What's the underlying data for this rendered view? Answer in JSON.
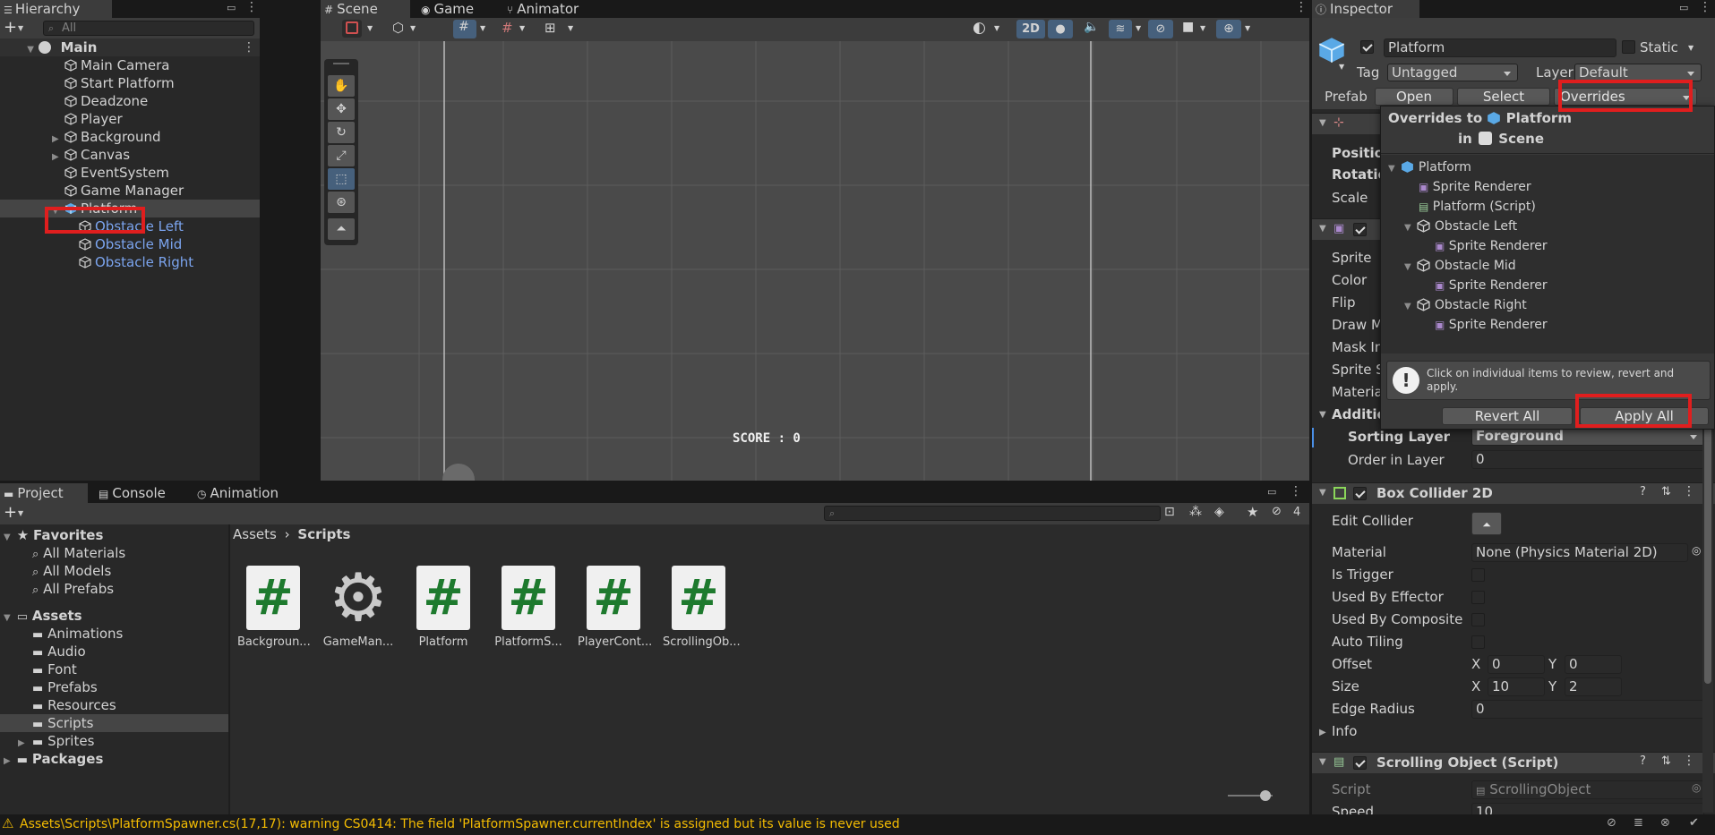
{
  "hierarchy": {
    "tab": "Hierarchy",
    "search_placeholder": "All",
    "scene": "Main",
    "items": [
      {
        "label": "Main Camera"
      },
      {
        "label": "Start Platform"
      },
      {
        "label": "Deadzone"
      },
      {
        "label": "Player"
      },
      {
        "label": "Background"
      },
      {
        "label": "Canvas"
      },
      {
        "label": "EventSystem"
      },
      {
        "label": "Game Manager"
      },
      {
        "label": "Platform"
      },
      {
        "label": "Obstacle Left"
      },
      {
        "label": "Obstacle Mid"
      },
      {
        "label": "Obstacle Right"
      }
    ]
  },
  "scene": {
    "tabs": [
      "Scene",
      "Game",
      "Animator"
    ],
    "mode_2d": "2D",
    "score_text": "SCORE : 0"
  },
  "project": {
    "tabs": [
      "Project",
      "Console",
      "Animation"
    ],
    "hidden_count": "4",
    "favorites": {
      "label": "Favorites",
      "items": [
        "All Materials",
        "All Models",
        "All Prefabs"
      ]
    },
    "assets": {
      "label": "Assets",
      "items": [
        "Animations",
        "Audio",
        "Font",
        "Prefabs",
        "Resources",
        "Scripts",
        "Sprites"
      ]
    },
    "packages": "Packages",
    "breadcrumb": [
      "Assets",
      "Scripts"
    ],
    "files": [
      {
        "name": "Backgroun...",
        "type": "script"
      },
      {
        "name": "GameMan...",
        "type": "gear"
      },
      {
        "name": "Platform",
        "type": "script"
      },
      {
        "name": "PlatformS...",
        "type": "script"
      },
      {
        "name": "PlayerCont...",
        "type": "script"
      },
      {
        "name": "ScrollingOb...",
        "type": "script"
      }
    ]
  },
  "inspector": {
    "tab": "Inspector",
    "object_name": "Platform",
    "static_label": "Static",
    "tag_label": "Tag",
    "tag_value": "Untagged",
    "layer_label": "Layer",
    "layer_value": "Default",
    "prefab_label": "Prefab",
    "open_button": "Open",
    "select_button": "Select",
    "overrides_button": "Overrides",
    "transform_labels": [
      "Position",
      "Rotation",
      "Scale"
    ],
    "sprite_labels": [
      "Sprite",
      "Color",
      "Flip",
      "Draw M",
      "Mask In",
      "Sprite S",
      "Materia"
    ],
    "additional_header": "Additio",
    "sorting_layer_label": "Sorting Layer",
    "sorting_layer_value": "Foreground",
    "order_label": "Order in Layer",
    "order_value": "0",
    "box_collider": {
      "title": "Box Collider 2D",
      "edit_collider": "Edit Collider",
      "material_label": "Material",
      "material_value": "None (Physics Material 2D)",
      "is_trigger": "Is Trigger",
      "used_by_effector": "Used By Effector",
      "used_by_composite": "Used By Composite",
      "auto_tiling": "Auto Tiling",
      "offset_label": "Offset",
      "offset_x": "0",
      "offset_y": "0",
      "size_label": "Size",
      "size_x": "10",
      "size_y": "2",
      "edge_radius_label": "Edge Radius",
      "edge_radius_value": "0",
      "info": "Info",
      "x": "X",
      "y": "Y"
    },
    "scrolling": {
      "title": "Scrolling Object (Script)",
      "script_label": "Script",
      "script_value": "ScrollingObject",
      "speed_label": "Speed",
      "speed_value": "10"
    }
  },
  "overrides_popup": {
    "title_prefix": "Overrides to",
    "title_object": "Platform",
    "in_label": "in",
    "in_object": "Scene",
    "tree": [
      {
        "label": "Platform",
        "level": 0,
        "kind": "prefab"
      },
      {
        "label": "Sprite Renderer",
        "level": 1,
        "kind": "component"
      },
      {
        "label": "Platform (Script)",
        "level": 1,
        "kind": "script"
      },
      {
        "label": "Obstacle Left",
        "level": 1,
        "kind": "object"
      },
      {
        "label": "Sprite Renderer",
        "level": 2,
        "kind": "component"
      },
      {
        "label": "Obstacle Mid",
        "level": 1,
        "kind": "object"
      },
      {
        "label": "Sprite Renderer",
        "level": 2,
        "kind": "component"
      },
      {
        "label": "Obstacle Right",
        "level": 1,
        "kind": "object"
      },
      {
        "label": "Sprite Renderer",
        "level": 2,
        "kind": "component"
      }
    ],
    "info_text": "Click on individual items to review, revert and apply.",
    "revert_all": "Revert All",
    "apply_all": "Apply All"
  },
  "status_bar": {
    "message": "Assets\\Scripts\\PlatformSpawner.cs(17,17): warning CS0414: The field 'PlatformSpawner.currentIndex' is assigned but its value is never used"
  },
  "colors": {
    "highlight": "#e01e1e",
    "prefab_blue": "#7ba4ee",
    "warning": "#f4bc02"
  }
}
